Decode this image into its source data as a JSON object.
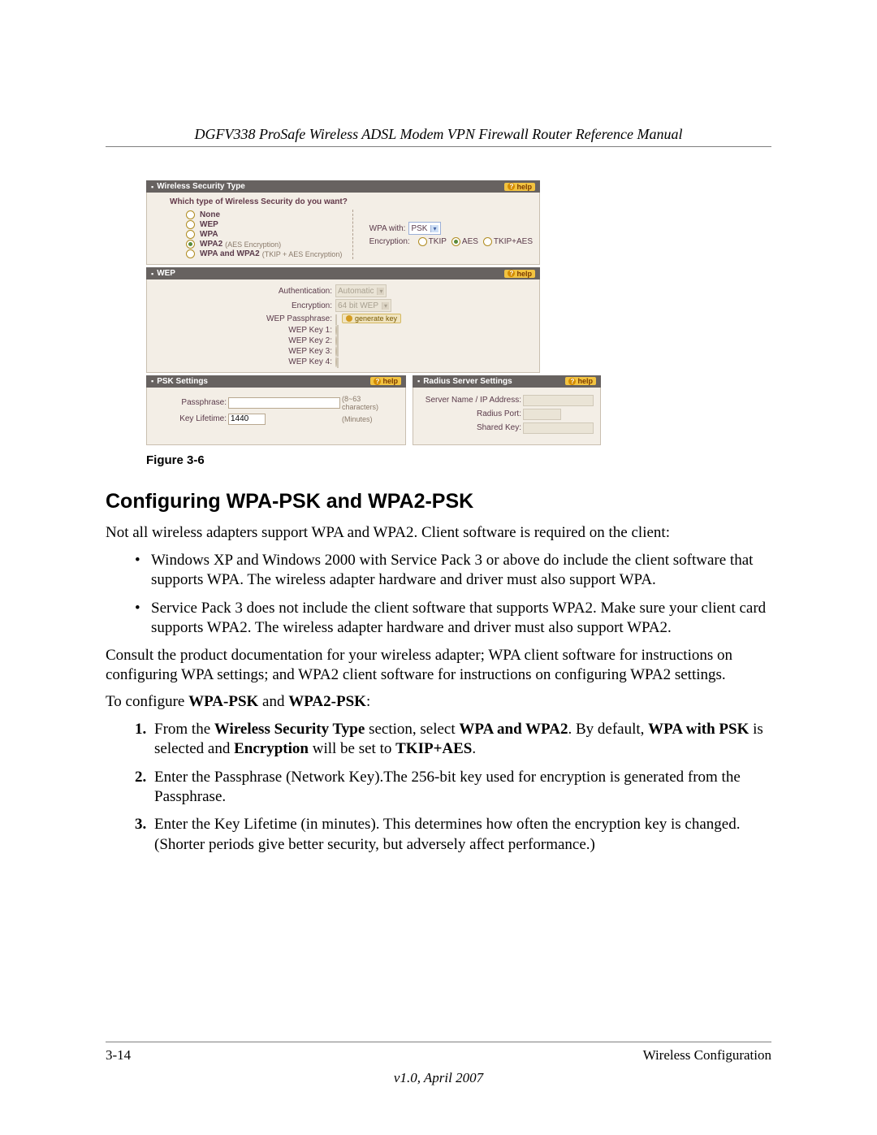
{
  "header": {
    "running_title": "DGFV338 ProSafe Wireless ADSL Modem VPN Firewall Router Reference Manual"
  },
  "figure": {
    "caption": "Figure 3-6",
    "help_label": "help",
    "panels": {
      "security_type": {
        "title": "Wireless Security Type",
        "question": "Which type of Wireless Security do you want?",
        "options": [
          {
            "label": "None",
            "sub": "",
            "checked": false
          },
          {
            "label": "WEP",
            "sub": "",
            "checked": false
          },
          {
            "label": "WPA",
            "sub": "",
            "checked": false
          },
          {
            "label": "WPA2",
            "sub": "(AES Encryption)",
            "checked": true
          },
          {
            "label": "WPA and WPA2",
            "sub": "(TKIP + AES Encryption)",
            "checked": false
          }
        ],
        "wpa_with_label": "WPA with:",
        "wpa_with_value": "PSK",
        "encryption_label": "Encryption:",
        "encryption_options": [
          {
            "label": "TKIP",
            "checked": false
          },
          {
            "label": "AES",
            "checked": true
          },
          {
            "label": "TKIP+AES",
            "checked": false
          }
        ]
      },
      "wep": {
        "title": "WEP",
        "auth_label": "Authentication:",
        "auth_value": "Automatic",
        "enc_label": "Encryption:",
        "enc_value": "64 bit WEP",
        "pass_label": "WEP Passphrase:",
        "generate_label": "generate key",
        "key_labels": [
          "WEP Key 1:",
          "WEP Key 2:",
          "WEP Key 3:",
          "WEP Key 4:"
        ]
      },
      "psk": {
        "title": "PSK Settings",
        "pass_label": "Passphrase:",
        "pass_value": "",
        "pass_hint": "(8~63 characters)",
        "life_label": "Key Lifetime:",
        "life_value": "1440",
        "life_hint": "(Minutes)"
      },
      "radius": {
        "title": "Radius Server Settings",
        "server_label": "Server Name / IP Address:",
        "port_label": "Radius Port:",
        "key_label": "Shared Key:"
      }
    }
  },
  "section": {
    "heading": "Configuring WPA-PSK and WPA2-PSK",
    "intro": "Not all wireless adapters support WPA and WPA2. Client software is required on the client:",
    "bullets": [
      "Windows XP and Windows 2000 with Service Pack 3 or above do include the client software that supports WPA. The wireless adapter hardware and driver must also support WPA.",
      "Service Pack 3 does not include the client software that supports WPA2. Make sure your client card supports WPA2. The wireless adapter hardware and driver must also support WPA2."
    ],
    "consult": "Consult the product documentation for your wireless adapter; WPA client software for instructions on configuring WPA settings; and WPA2 client software for instructions on configuring WPA2 settings.",
    "to_configure_pre": "To configure ",
    "to_configure_b1": "WPA-PSK",
    "to_configure_mid": " and ",
    "to_configure_b2": "WPA2-PSK",
    "to_configure_post": ":",
    "steps": {
      "s1_a": "From the ",
      "s1_b1": "Wireless Security Type",
      "s1_b": " section, select ",
      "s1_b2": "WPA and WPA2",
      "s1_c": ". By default, ",
      "s1_b3": "WPA with PSK",
      "s1_d": " is selected and ",
      "s1_b4": "Encryption",
      "s1_e": " will be set to ",
      "s1_b5": "TKIP+AES",
      "s1_f": ".",
      "s2": "Enter the Passphrase (Network Key).The 256-bit key used for encryption is generated from the Passphrase.",
      "s3": "Enter the Key Lifetime (in minutes). This determines how often the encryption key is changed. (Shorter periods give better security, but adversely affect performance.)"
    }
  },
  "footer": {
    "page": "3-14",
    "chapter": "Wireless Configuration",
    "version": "v1.0, April 2007"
  }
}
